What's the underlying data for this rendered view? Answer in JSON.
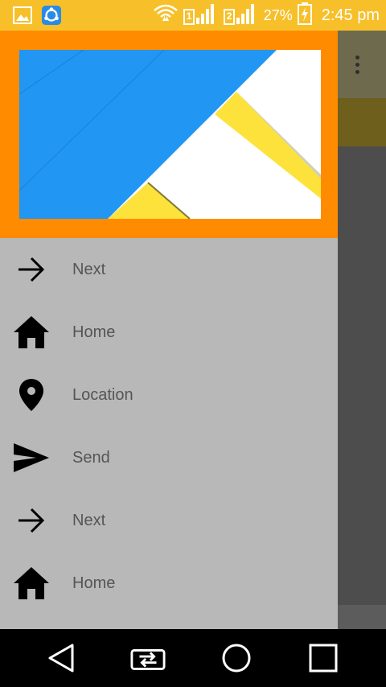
{
  "status_bar": {
    "battery_percent": "27%",
    "time": "2:45 pm",
    "sim1_label": "1",
    "sim2_label": "2",
    "icons": [
      "gallery-icon",
      "sync-app-icon",
      "wifi-icon",
      "signal-sim1-icon",
      "signal-sim2-icon",
      "battery-charging-icon"
    ]
  },
  "drawer": {
    "items": [
      {
        "label": "Next",
        "icon": "arrow-right-icon"
      },
      {
        "label": "Home",
        "icon": "home-icon"
      },
      {
        "label": "Location",
        "icon": "location-pin-icon"
      },
      {
        "label": "Send",
        "icon": "send-icon"
      },
      {
        "label": "Next",
        "icon": "arrow-right-icon"
      },
      {
        "label": "Home",
        "icon": "home-icon"
      }
    ]
  },
  "navigation_bar": {
    "buttons": [
      "back-button",
      "recent-apps-button",
      "home-button",
      "overview-button"
    ]
  },
  "colors": {
    "status_bar": "#f7c02a",
    "drawer_header": "#ff8c00",
    "drawer_bg": "#b8b8b8",
    "art_blue": "#2196f3",
    "art_yellow": "#fde23c"
  }
}
